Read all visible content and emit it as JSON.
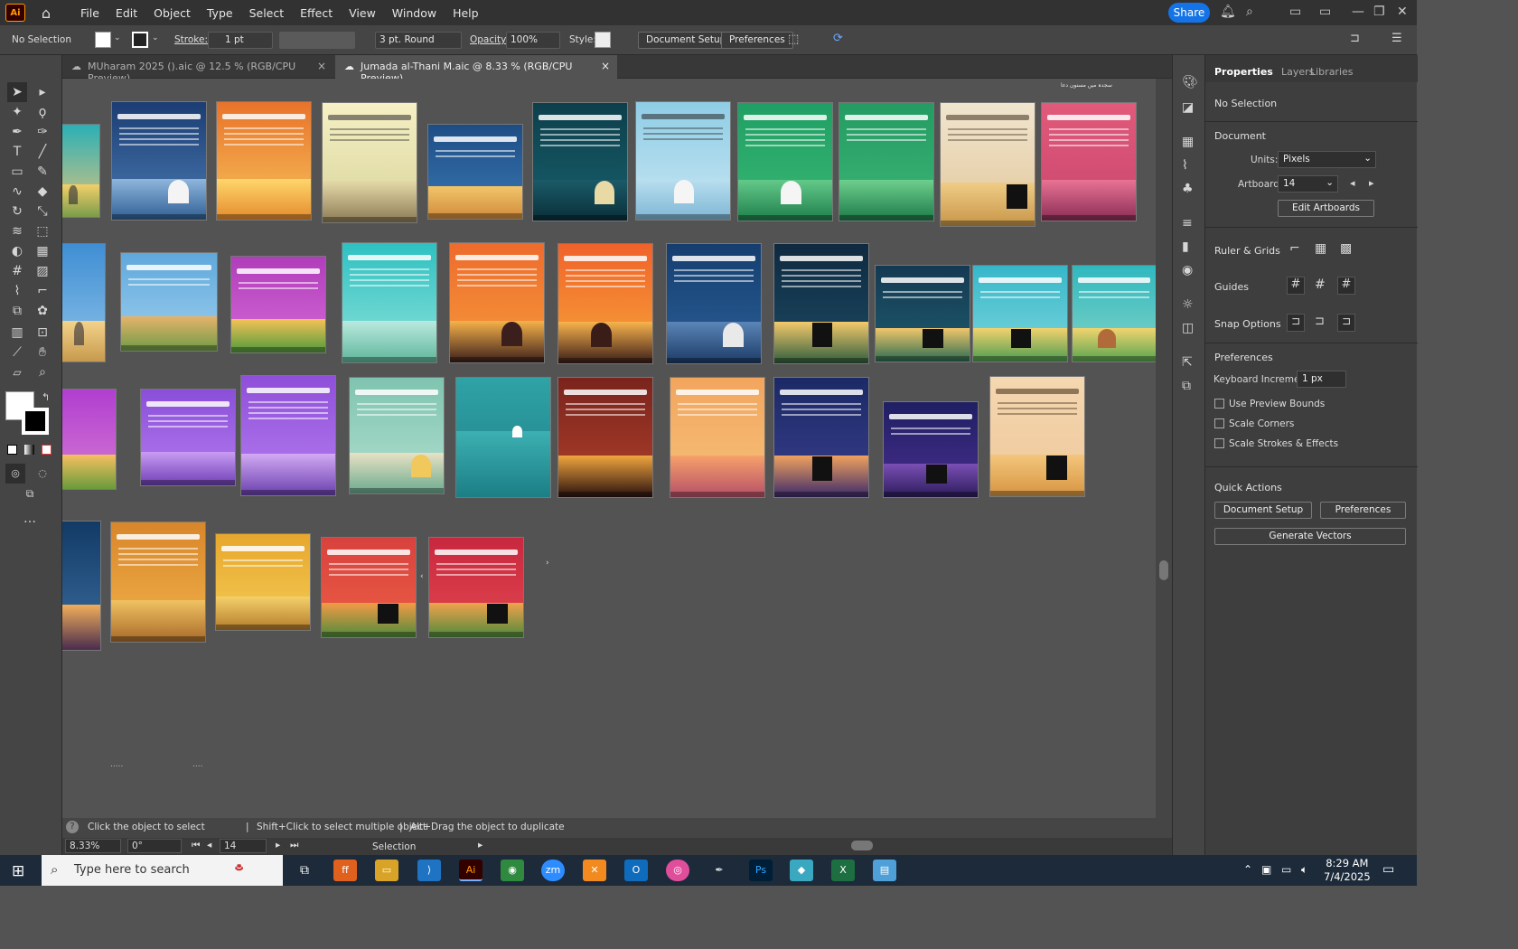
{
  "app": {
    "logo": "Ai",
    "home_icon": "home-icon"
  },
  "menu": [
    "File",
    "Edit",
    "Object",
    "Type",
    "Select",
    "Effect",
    "View",
    "Window",
    "Help"
  ],
  "share_label": "Share",
  "control": {
    "selection": "No Selection",
    "stroke_label": "Stroke:",
    "stroke_value": "1 pt",
    "brush": "3 pt. Round",
    "opacity_label": "Opacity:",
    "opacity_value": "100%",
    "style_label": "Style:",
    "document_setup": "Document Setup",
    "preferences": "Preferences"
  },
  "tabs": [
    {
      "label": "MUharam 2025 ().aic @ 12.5 % (RGB/CPU Preview)",
      "close": "×",
      "active": false
    },
    {
      "label": "Jumada al-Thani M.aic @ 8.33 % (RGB/CPU Preview)",
      "close": "×",
      "active": true
    }
  ],
  "canvas": {
    "top_label": "سجدہ میں مسنون دعا"
  },
  "hint": {
    "click": "Click the object to select",
    "shift": "Shift+Click to select multiple object",
    "alt": "Alt+Drag the object to duplicate"
  },
  "status": {
    "zoom": "8.33%",
    "rotation": "0°",
    "artboard": "14",
    "mode": "Selection"
  },
  "properties": {
    "tabs": [
      "Properties",
      "Layers",
      "Libraries"
    ],
    "no_selection": "No Selection",
    "document": "Document",
    "units_label": "Units:",
    "units_value": "Pixels",
    "artboard_label": "Artboard:",
    "artboard_value": "14",
    "edit_artboards": "Edit Artboards",
    "ruler_grids": "Ruler & Grids",
    "guides": "Guides",
    "snap_options": "Snap Options",
    "preferences_heading": "Preferences",
    "keyboard_increment_label": "Keyboard Increment:",
    "keyboard_increment_value": "1 px",
    "checkboxes": [
      "Use Preview Bounds",
      "Scale Corners",
      "Scale Strokes & Effects"
    ],
    "quick_actions": "Quick Actions",
    "document_setup": "Document Setup",
    "preferences": "Preferences",
    "generate_vectors": "Generate Vectors"
  },
  "taskbar": {
    "search_placeholder": "Type here to search",
    "time": "8:29 AM",
    "date": "7/4/2025"
  },
  "colors": {
    "accent": "#1473e6",
    "menubar": "#323232",
    "panel": "#454545",
    "canvas": "#535353"
  }
}
